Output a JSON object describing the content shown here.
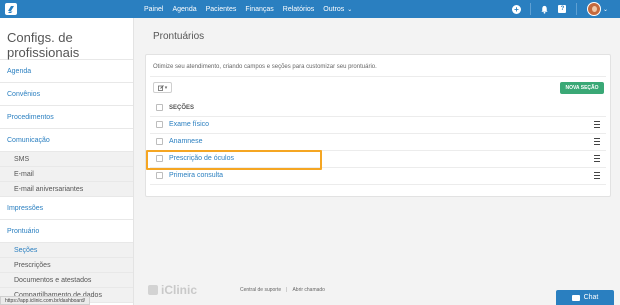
{
  "topbar": {
    "nav": [
      "Painel",
      "Agenda",
      "Pacientes",
      "Finanças",
      "Relatórios",
      "Outros"
    ],
    "icons": [
      "plus-circle-icon",
      "bell-icon",
      "help-icon",
      "avatar"
    ],
    "help_glyph": "?"
  },
  "sidebar": {
    "title": "Configs. de profissionais",
    "items": [
      {
        "label": "Agenda"
      },
      {
        "label": "Convênios"
      },
      {
        "label": "Procedimentos"
      },
      {
        "label": "Comunicação"
      }
    ],
    "comunicacao_sub": [
      "SMS",
      "E-mail",
      "E-mail aniversariantes"
    ],
    "items2": [
      {
        "label": "Impressões"
      },
      {
        "label": "Prontuário"
      }
    ],
    "prontuario_sub": [
      "Seções",
      "Prescrições",
      "Documentos e atestados",
      "Compartilhamento de dados"
    ]
  },
  "main": {
    "title": "Prontuários",
    "intro": "Otimize seu atendimento, criando campos e seções para customizar seu prontuário.",
    "new_section_button": "NOVA SEÇÃO",
    "table_header": "SEÇÕES",
    "sections": [
      "Exame físico",
      "Anamnese",
      "Prescrição de óculos",
      "Primeira consulta"
    ]
  },
  "footer": {
    "brand": "iClinic",
    "links": [
      "Central de suporte",
      "Abrir chamado"
    ],
    "separator": "|",
    "status_url": "https://app.iclinic.com.br/dashboard/",
    "chat_label": "Chat"
  },
  "colors": {
    "primary": "#2a7fc0",
    "success": "#3aa876",
    "highlight": "#f5a623"
  }
}
